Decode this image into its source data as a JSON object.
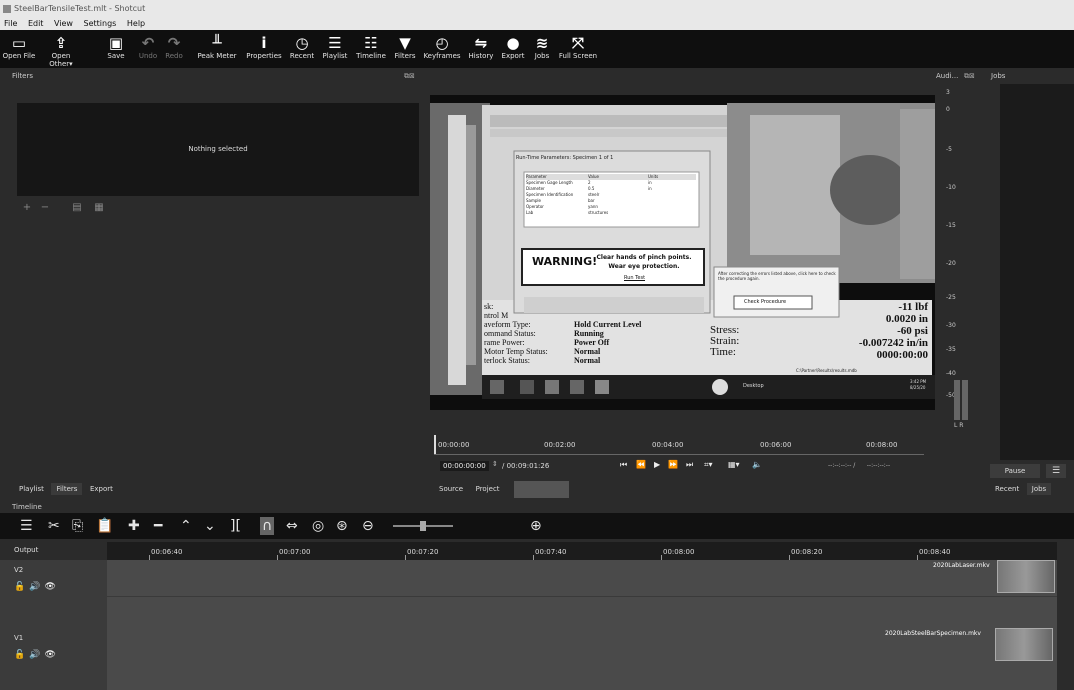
{
  "window": {
    "title": "SteelBarTensileTest.mlt - Shotcut"
  },
  "menu": [
    "File",
    "Edit",
    "View",
    "Settings",
    "Help"
  ],
  "toolbar": {
    "open_file": "Open File",
    "open_other": "Open Other▾",
    "save": "Save",
    "undo": "Undo",
    "redo": "Redo",
    "peak_meter": "Peak Meter",
    "properties": "Properties",
    "recent": "Recent",
    "playlist": "Playlist",
    "timeline": "Timeline",
    "filters": "Filters",
    "keyframes": "Keyframes",
    "history": "History",
    "export": "Export",
    "jobs": "Jobs",
    "full_screen": "Full Screen"
  },
  "filters": {
    "title": "Filters",
    "empty": "Nothing selected"
  },
  "left_tabs": {
    "playlist": "Playlist",
    "filters": "Filters",
    "export": "Export"
  },
  "player": {
    "ruler": [
      "00:00:00",
      "00:02:00",
      "00:04:00",
      "00:06:00",
      "00:08:00"
    ],
    "timecode": "00:00:00:00",
    "duration": "/ 00:09:01:26",
    "in_out": "--:--:--:-- /      --:--:--:--",
    "source_tab": "Source",
    "project_tab": "Project"
  },
  "video": {
    "dialog_title": "Run-Time Parameters: Specimen 1 of 1",
    "param_headers": [
      "Parameter",
      "Value",
      "Units"
    ],
    "params": [
      [
        "Specimen Gage Length",
        "2",
        "in"
      ],
      [
        "Diameter",
        "0.5",
        "in"
      ],
      [
        "Specimen Identification",
        "steelr",
        ""
      ],
      [
        "Sample",
        "bar",
        ""
      ],
      [
        "Operator",
        "yann",
        ""
      ],
      [
        "Lab",
        "structures",
        ""
      ]
    ],
    "warning": "WARNING!",
    "warning_text_1": "Clear hands of pinch points.",
    "warning_text_2": "Wear eye protection.",
    "run_test": "Run Test",
    "check_text": "After correcting the errors listed above, click here to check the procedure again.",
    "check_button": "Check Procedure",
    "status_labels": [
      "sk:",
      "ntrol M",
      "aveform Type:",
      "ommand Status:",
      "rame Power:",
      "Motor Temp Status:",
      "terlock Status:"
    ],
    "status_values": [
      "",
      "",
      "Hold Current Level",
      "Running",
      "Power Off",
      "Normal",
      "Normal"
    ],
    "readout_labels": [
      "",
      "",
      "Stress:",
      "Strain:",
      "Time:"
    ],
    "readout_values": [
      "-11 lbf",
      "0.0020 in",
      "-60 psi",
      "-0.007242 in/in",
      "0000:00:00"
    ],
    "path": "C:\\Partner\\Results\\results.mdb",
    "taskbar_desktop": "Desktop",
    "taskbar_time": "3:42 PM",
    "taskbar_date": "8/25/20"
  },
  "audio": {
    "title": "Audi...",
    "scale": [
      "3",
      "0",
      "-5",
      "-10",
      "-15",
      "-20",
      "-25",
      "-30",
      "-35",
      "-40",
      "-50"
    ],
    "lr": "L R"
  },
  "jobs": {
    "title": "Jobs",
    "pause": "Pause",
    "recent_tab": "Recent",
    "jobs_tab": "Jobs"
  },
  "timeline": {
    "label": "Timeline",
    "output": "Output",
    "ruler": [
      "00:06:40",
      "00:07:00",
      "00:07:20",
      "00:07:40",
      "00:08:00",
      "00:08:20",
      "00:08:40"
    ],
    "tracks": [
      {
        "name": "V2",
        "clip": "2020LabLaser.mkv"
      },
      {
        "name": "V1",
        "clip": "2020LabSteelBarSpecimen.mkv"
      }
    ]
  }
}
